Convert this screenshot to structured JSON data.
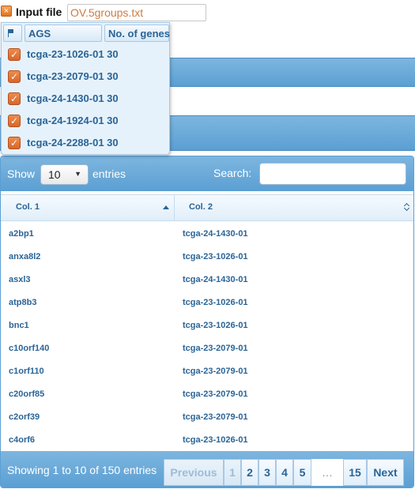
{
  "input": {
    "label": "Input file",
    "value": "OV.5groups.txt",
    "toggle_glyph": "×"
  },
  "groups": {
    "header": {
      "ags": "AGS",
      "num_genes": "No. of genes"
    },
    "items": [
      {
        "label": "tcga-23-1026-01 30",
        "checked": true
      },
      {
        "label": "tcga-23-2079-01 30",
        "checked": true
      },
      {
        "label": "tcga-24-1430-01 30",
        "checked": true
      },
      {
        "label": "tcga-24-1924-01 30",
        "checked": true
      },
      {
        "label": "tcga-24-2288-01 30",
        "checked": true
      }
    ],
    "check_glyph": "✓"
  },
  "table": {
    "show_label": "Show",
    "page_size": "10",
    "entries_label": "entries",
    "search_label": "Search:",
    "search_value": "",
    "columns": [
      "Col. 1",
      "Col. 2"
    ],
    "rows": [
      [
        "a2bp1",
        "tcga-24-1430-01"
      ],
      [
        "anxa8l2",
        "tcga-23-1026-01"
      ],
      [
        "asxl3",
        "tcga-24-1430-01"
      ],
      [
        "atp8b3",
        "tcga-23-1026-01"
      ],
      [
        "bnc1",
        "tcga-23-1026-01"
      ],
      [
        "c10orf140",
        "tcga-23-2079-01"
      ],
      [
        "c1orf110",
        "tcga-23-2079-01"
      ],
      [
        "c20orf85",
        "tcga-23-2079-01"
      ],
      [
        "c2orf39",
        "tcga-23-2079-01"
      ],
      [
        "c4orf6",
        "tcga-23-1026-01"
      ]
    ],
    "info": "Showing 1 to 10 of 150 entries",
    "pagination": {
      "previous": "Previous",
      "pages": [
        "1",
        "2",
        "3",
        "4",
        "5"
      ],
      "ellipsis": "…",
      "last": "15",
      "next": "Next",
      "current": "1"
    }
  },
  "colors": {
    "accent_blue": "#5b9fd3",
    "link_blue": "#2a6496",
    "checkbox_orange": "#e3731a",
    "input_text": "#d07a3e"
  }
}
